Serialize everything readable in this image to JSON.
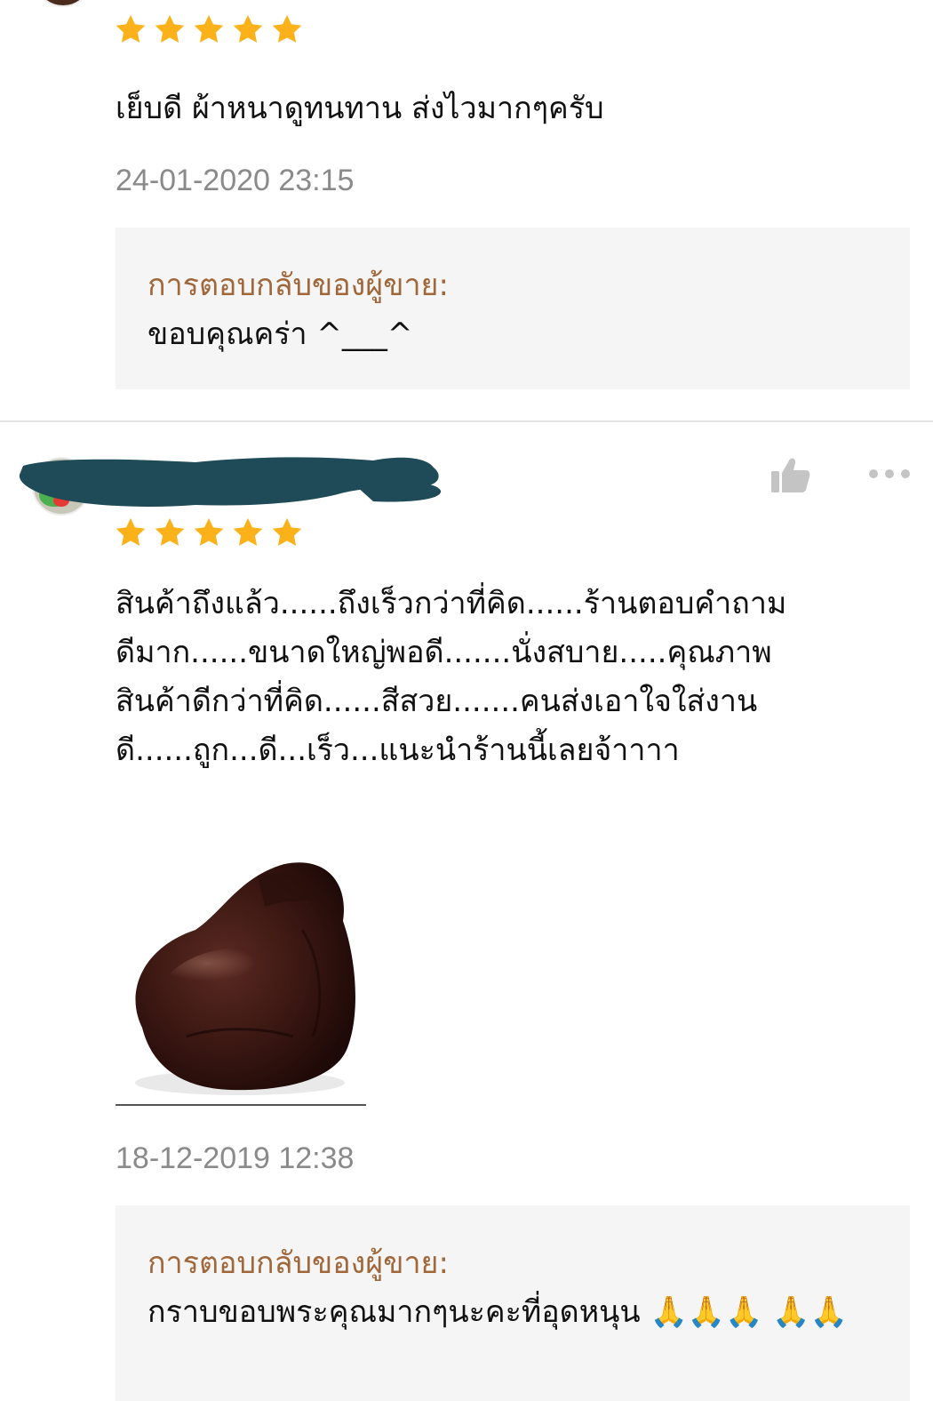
{
  "reviews": [
    {
      "rating": 5,
      "comment": "เย็บดี ผ้าหนาดูทนทาน  ส่งไวมากๆครับ",
      "timestamp": "24-01-2020 23:15",
      "seller_reply": {
        "label": "การตอบกลับของผู้ขาย:",
        "text": "ขอบคุณคร่า  ^___^"
      }
    },
    {
      "rating": 5,
      "username_redacted": true,
      "comment_lines": [
        "สินค้าถึงแล้ว......ถึงเร็วกว่าที่คิด......ร้านตอบคำถาม",
        "ดีมาก......ขนาดใหญ่พอดี.......นั่งสบาย.....คุณภาพ",
        "สินค้าดีกว่าที่คิด......สีสวย.......คนส่งเอาใจใส่งาน",
        "ดี......ถูก...ดี...เร็ว...แนะนำร้านนี้เลยจ้าาาา"
      ],
      "photo": "brown-leather-bean-bag",
      "timestamp": "18-12-2019 12:38",
      "seller_reply": {
        "label": "การตอบกลับของผู้ขาย:",
        "text": "กราบขอบพระคุณมากๆนะคะที่อุดหนุน  🙏🙏🙏 🙏🙏"
      }
    }
  ],
  "icons": {
    "star": "star-icon",
    "like": "thumbs-up-icon",
    "more": "more-options-icon"
  },
  "colors": {
    "star": "#fbb21a",
    "seller_label": "#a0673a",
    "timestamp": "#8a8a8a",
    "reply_background": "#f5f5f5",
    "redaction": "#1f4a57"
  }
}
